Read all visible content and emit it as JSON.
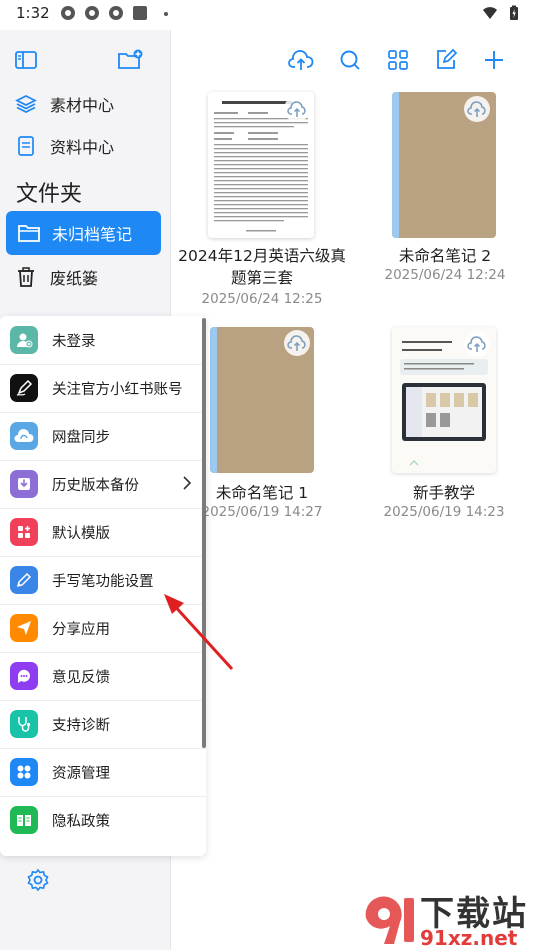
{
  "status_bar": {
    "time": "1:32"
  },
  "sidebar": {
    "items": [
      {
        "label": "素材中心",
        "icon": "layers-icon"
      },
      {
        "label": "资料中心",
        "icon": "document-icon"
      }
    ],
    "folder_heading": "文件夹",
    "folders": [
      {
        "label": "未归档笔记",
        "icon": "folder-icon",
        "active": true
      },
      {
        "label": "废纸篓",
        "icon": "trash-icon",
        "active": false
      }
    ]
  },
  "notes": [
    {
      "title": "2024年12月英语六级真题第三套",
      "date": "2025/06/24 12:25",
      "cover": "document-preview"
    },
    {
      "title": "未命名笔记 2",
      "date": "2025/06/24 12:24",
      "cover": "kraft"
    },
    {
      "title": "未命名笔记 1",
      "date": "2025/06/19 14:27",
      "cover": "kraft"
    },
    {
      "title": "新手教学",
      "date": "2025/06/19 14:23",
      "cover": "tutorial"
    }
  ],
  "menu": {
    "items": [
      {
        "label": "未登录",
        "icon": "user-icon",
        "color": "#5bb8a6"
      },
      {
        "label": "关注官方小红书账号",
        "icon": "pen-nib-icon",
        "color": "#111111"
      },
      {
        "label": "网盘同步",
        "icon": "cloud-sync-icon",
        "color": "#5aa7e6"
      },
      {
        "label": "历史版本备份",
        "icon": "backup-icon",
        "color": "#8b6fd6",
        "has_arrow": true
      },
      {
        "label": "默认模版",
        "icon": "template-icon",
        "color": "#f0405a"
      },
      {
        "label": "手写笔功能设置",
        "icon": "stylus-icon",
        "color": "#3a86e8"
      },
      {
        "label": "分享应用",
        "icon": "share-icon",
        "color": "#ff8a00"
      },
      {
        "label": "意见反馈",
        "icon": "feedback-icon",
        "color": "#8e3df0"
      },
      {
        "label": "支持诊断",
        "icon": "stethoscope-icon",
        "color": "#19c3a8"
      },
      {
        "label": "资源管理",
        "icon": "grid-icon",
        "color": "#1e88f5"
      },
      {
        "label": "隐私政策",
        "icon": "book-icon",
        "color": "#1fba55"
      }
    ]
  },
  "watermark": {
    "text": "下载站",
    "url": "91xz.net"
  },
  "colors": {
    "accent": "#1e88f5",
    "kraft": "#b9a282",
    "arrow": "#e02020"
  }
}
